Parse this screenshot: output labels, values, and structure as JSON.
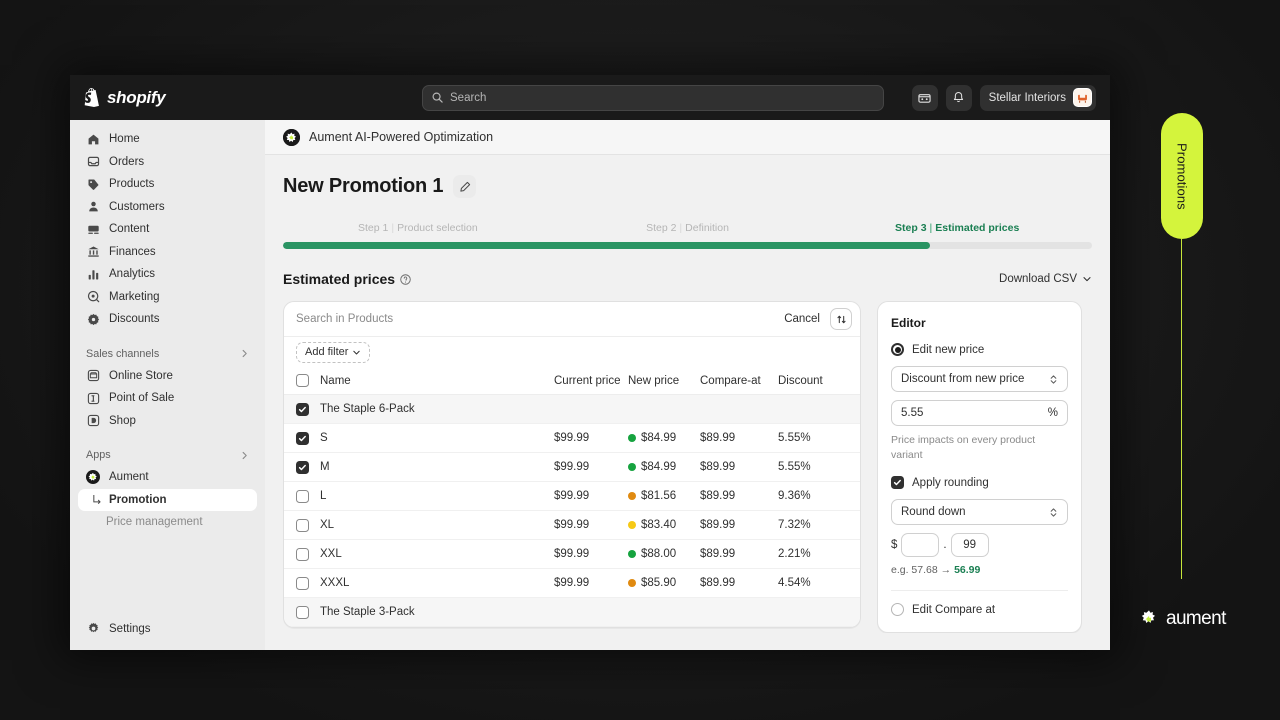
{
  "topbar": {
    "brand": "shopify",
    "search_placeholder": "Search",
    "store_name": "Stellar Interiors",
    "icons": [
      "store-icon",
      "bell-icon"
    ]
  },
  "sidebar": {
    "items": [
      {
        "label": "Home",
        "icon": "home-icon"
      },
      {
        "label": "Orders",
        "icon": "orders-icon"
      },
      {
        "label": "Products",
        "icon": "tag-icon"
      },
      {
        "label": "Customers",
        "icon": "person-icon"
      },
      {
        "label": "Content",
        "icon": "content-icon"
      },
      {
        "label": "Finances",
        "icon": "bank-icon"
      },
      {
        "label": "Analytics",
        "icon": "bar-chart-icon"
      },
      {
        "label": "Marketing",
        "icon": "target-icon"
      },
      {
        "label": "Discounts",
        "icon": "discount-icon"
      }
    ],
    "sales_channels": {
      "label": "Sales channels",
      "items": [
        {
          "label": "Online Store",
          "icon": "store-front-icon"
        },
        {
          "label": "Point of Sale",
          "icon": "pos-icon"
        },
        {
          "label": "Shop",
          "icon": "shop-icon"
        }
      ]
    },
    "apps": {
      "label": "Apps",
      "items": [
        {
          "label": "Aument",
          "icon": "aument-icon"
        },
        {
          "label": "Promotion",
          "icon": "branch-arrow-icon",
          "active": true
        },
        {
          "label": "Price management",
          "icon": "",
          "muted": true
        }
      ]
    },
    "settings": {
      "label": "Settings",
      "icon": "gear-icon"
    }
  },
  "app_header": {
    "title": "Aument AI-Powered Optimization",
    "icon": "aument-icon"
  },
  "page": {
    "title": "New Promotion 1",
    "edit_icon": "pencil-icon"
  },
  "stepper": {
    "progress_percent": 80,
    "steps": [
      {
        "number": "Step 1",
        "label": "Product selection",
        "state": "done"
      },
      {
        "number": "Step 2",
        "label": "Definition",
        "state": "done"
      },
      {
        "number": "Step 3",
        "label": "Estimated prices",
        "state": "current"
      }
    ]
  },
  "section": {
    "heading": "Estimated prices",
    "help_icon": "question-circle-icon",
    "download_label": "Download CSV",
    "download_caret": "chevron-down-icon"
  },
  "table_toolbar": {
    "search_placeholder": "Search in Products",
    "cancel_label": "Cancel",
    "sort_icon": "sort-icon",
    "add_filter_label": "Add filter",
    "add_filter_caret": "chevron-down-icon"
  },
  "table": {
    "columns": [
      "Name",
      "Current price",
      "New price",
      "Compare-at",
      "Discount"
    ],
    "header_checkbox_checked": false,
    "rows": [
      {
        "type": "group",
        "name": "The Staple 6-Pack",
        "checked": true
      },
      {
        "type": "variant",
        "name": "S",
        "checked": true,
        "current_price": "$99.99",
        "new_price": "$84.99",
        "dot": "#16a33f",
        "compare_at": "$89.99",
        "discount": "5.55%"
      },
      {
        "type": "variant",
        "name": "M",
        "checked": true,
        "current_price": "$99.99",
        "new_price": "$84.99",
        "dot": "#16a33f",
        "compare_at": "$89.99",
        "discount": "5.55%"
      },
      {
        "type": "variant",
        "name": "L",
        "checked": false,
        "current_price": "$99.99",
        "new_price": "$81.56",
        "dot": "#e08a10",
        "compare_at": "$89.99",
        "discount": "9.36%"
      },
      {
        "type": "variant",
        "name": "XL",
        "checked": false,
        "current_price": "$99.99",
        "new_price": "$83.40",
        "dot": "#f6c916",
        "compare_at": "$89.99",
        "discount": "7.32%"
      },
      {
        "type": "variant",
        "name": "XXL",
        "checked": false,
        "current_price": "$99.99",
        "new_price": "$88.00",
        "dot": "#16a33f",
        "compare_at": "$89.99",
        "discount": "2.21%"
      },
      {
        "type": "variant",
        "name": "XXXL",
        "checked": false,
        "current_price": "$99.99",
        "new_price": "$85.90",
        "dot": "#e08a10",
        "compare_at": "$89.99",
        "discount": "4.54%"
      },
      {
        "type": "group",
        "name": "The Staple 3-Pack",
        "checked": false
      }
    ]
  },
  "editor": {
    "title": "Editor",
    "edit_new_price_label": "Edit new price",
    "edit_new_price_selected": true,
    "discount_type_value": "Discount from new price",
    "discount_amount_value": "5.55",
    "discount_unit": "%",
    "hint": "Price impacts on every product variant",
    "apply_rounding_label": "Apply rounding",
    "apply_rounding_checked": true,
    "rounding_mode_value": "Round down",
    "currency_symbol": "$",
    "round_whole_value": "",
    "round_decimal_separator": ".",
    "round_cents_value": "99",
    "example_prefix": "e.g. 57.68",
    "example_arrow": "→",
    "example_result": "56.99",
    "edit_compare_at_label": "Edit Compare at",
    "edit_compare_at_selected": false
  },
  "rail": {
    "promotions_tab_label": "Promotions",
    "brand_word": "aument",
    "accent_color": "#d4f43c"
  }
}
